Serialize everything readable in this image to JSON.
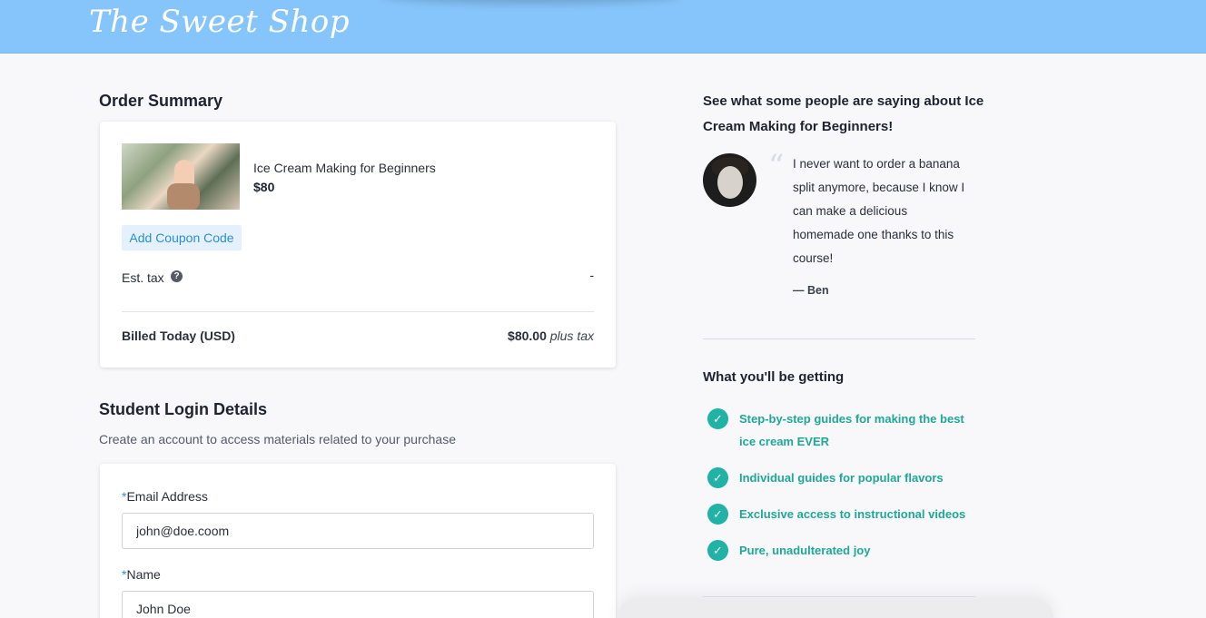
{
  "header": {
    "logo": "The Sweet Shop"
  },
  "order_summary": {
    "title": "Order Summary",
    "product": {
      "name": "Ice Cream Making for Beginners",
      "price": "$80"
    },
    "coupon_label": "Add Coupon Code",
    "tax_label": "Est. tax",
    "tax_help": "?",
    "tax_value": "-",
    "billed_label": "Billed Today (USD)",
    "billed_amount": "$80.00",
    "billed_suffix": "plus tax"
  },
  "login": {
    "title": "Student Login Details",
    "subtitle": "Create an account to access materials related to your purchase",
    "required_mark": "*",
    "email_label": "Email Address",
    "email_value": "john@doe.coom",
    "name_label": "Name",
    "name_value": "John Doe"
  },
  "testimonial": {
    "heading": "See what some people are saying about Ice Cream Making for Beginners!",
    "quote_mark": "“",
    "quote": "I never want to order a banana split anymore, because I know I can make a delicious homemade one thanks to this course!",
    "author": "— Ben"
  },
  "benefits": {
    "title": "What you'll be getting",
    "check_glyph": "✓",
    "items": [
      "Step-by-step guides for making the best ice cream EVER",
      "Individual guides for popular flavors",
      "Exclusive access to instructional videos",
      "Pure, unadulterated joy"
    ]
  }
}
